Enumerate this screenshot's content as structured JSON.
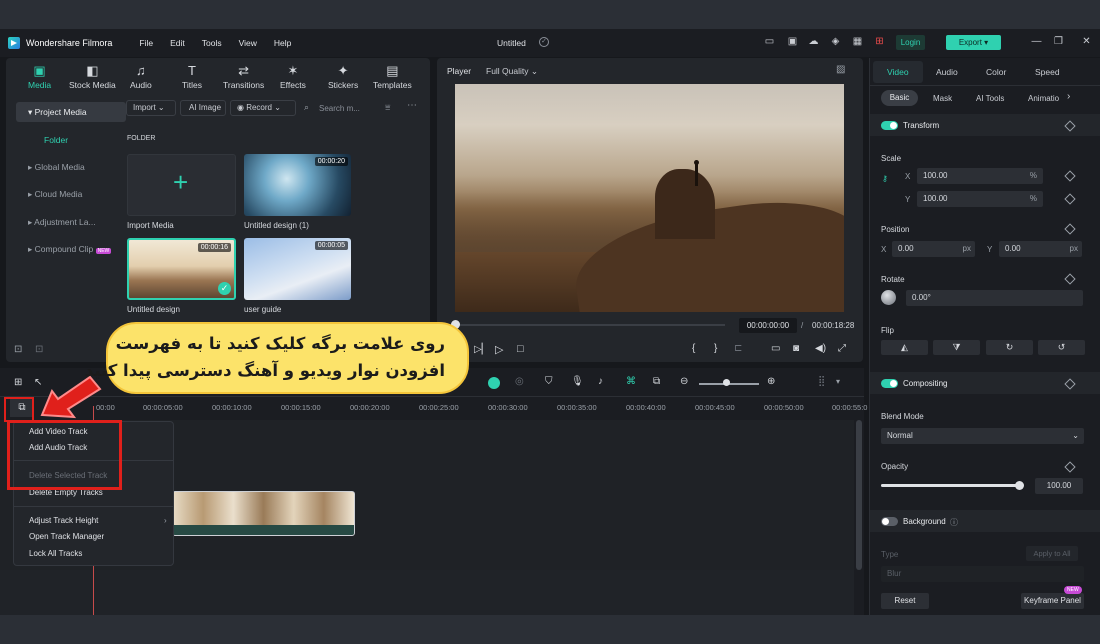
{
  "app": {
    "name": "Wondershare Filmora",
    "document_title": "Untitled"
  },
  "menu": [
    "File",
    "Edit",
    "Tools",
    "View",
    "Help"
  ],
  "titlebar": {
    "login": "Login",
    "export": "Export"
  },
  "media_tabs": [
    {
      "label": "Media",
      "icon": "media-icon",
      "glyph": "▣"
    },
    {
      "label": "Stock Media",
      "icon": "stock-media-icon",
      "glyph": "◧"
    },
    {
      "label": "Audio",
      "icon": "audio-icon",
      "glyph": "♫"
    },
    {
      "label": "Titles",
      "icon": "titles-icon",
      "glyph": "T"
    },
    {
      "label": "Transitions",
      "icon": "transitions-icon",
      "glyph": "⇄"
    },
    {
      "label": "Effects",
      "icon": "effects-icon",
      "glyph": "✶"
    },
    {
      "label": "Stickers",
      "icon": "stickers-icon",
      "glyph": "✦"
    },
    {
      "label": "Templates",
      "icon": "templates-icon",
      "glyph": "▤"
    }
  ],
  "sidebar": {
    "project_media": "Project Media",
    "folder": "Folder",
    "items": [
      "Global Media",
      "Cloud Media",
      "Adjustment La...",
      "Compound Clip"
    ],
    "new_badge": "NEW"
  },
  "media_toolbar": {
    "import": "Import",
    "ai_image": "AI Image",
    "record": "Record",
    "search_placeholder": "Search m..."
  },
  "media_area": {
    "folder_label": "FOLDER",
    "clips": [
      {
        "name": "Import Media",
        "duration": ""
      },
      {
        "name": "Untitled design (1)",
        "duration": "00:00:20"
      },
      {
        "name": "Untitled design",
        "duration": "00:00:16"
      },
      {
        "name": "user guide",
        "duration": "00:00:05"
      }
    ]
  },
  "player": {
    "label": "Player",
    "quality": "Full Quality",
    "current_time": "00:00:00:00",
    "total_time": "00:00:18:28"
  },
  "right_panel": {
    "tabs": [
      "Video",
      "Audio",
      "Color",
      "Speed"
    ],
    "subtabs": [
      "Basic",
      "Mask",
      "AI Tools",
      "Animatio"
    ],
    "transform": "Transform",
    "scale": "Scale",
    "scale_x": "100.00",
    "scale_y": "100.00",
    "pct": "%",
    "position": "Position",
    "pos_x": "0.00",
    "pos_y": "0.00",
    "px": "px",
    "rotate": "Rotate",
    "rotate_value": "0.00°",
    "flip": "Flip",
    "compositing": "Compositing",
    "blend_mode": "Blend Mode",
    "blend_value": "Normal",
    "opacity": "Opacity",
    "opacity_value": "100.00",
    "opacity_level": 1.0,
    "background": "Background",
    "type": "Type",
    "apply_to_all": "Apply to All",
    "blur": "Blur",
    "reset": "Reset",
    "keyframe": "Keyframe Panel",
    "new_badge": "NEW"
  },
  "timeline": {
    "ruler": [
      "00:00",
      "00:00:05:00",
      "00:00:10:00",
      "00:00:15:00",
      "00:00:20:00",
      "00:00:25:00",
      "00:00:30:00",
      "00:00:35:00",
      "00:00:40:00",
      "00:00:45:00",
      "00:00:50:00",
      "00:00:55:0"
    ]
  },
  "context_menu": {
    "items": [
      "Add Video Track",
      "Add Audio Track",
      "Delete Selected Track",
      "Delete Empty Tracks",
      "Adjust Track Height",
      "Open Track Manager",
      "Lock All Tracks"
    ]
  },
  "callout": {
    "line1": "روی  علامت برگه کلیک کنید تا به فهرست",
    "line2": "افزودن نوار ویدیو و آهنگ دسترسی پیدا کنید"
  },
  "colors": {
    "accent": "#2fd1b0",
    "callout_bg": "#fce36a",
    "highlight": "#e0201b"
  }
}
